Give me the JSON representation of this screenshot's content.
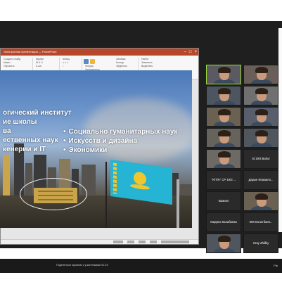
{
  "app": {
    "window_title": "Электронная презентация — PowerPoint",
    "window_buttons": [
      "–",
      "□",
      "×"
    ]
  },
  "ribbon": {
    "groups": [
      {
        "lines": [
          "Создать слайд",
          "Макет",
          "Сбросить"
        ]
      },
      {
        "lines": [
          "Шрифт",
          "Ж  К  Ч",
          "А  Аа"
        ]
      },
      {
        "lines": [
          "Абзац",
          "≡  ≡  ≡",
          "↕"
        ]
      },
      {
        "lines": [
          "Фигуры",
          "Упорядочить",
          "Экспресс"
        ]
      },
      {
        "lines": [
          "Заливка",
          "Контур",
          "Эффекты"
        ]
      },
      {
        "lines": [
          "Найти",
          "Заменить",
          "Выделить"
        ]
      }
    ],
    "accent": "#b7472a"
  },
  "slide": {
    "left_lines": [
      "огический институт",
      "ие школы",
      "ва",
      "ественных наук",
      "кенерии и IT"
    ],
    "right_bullets": [
      "Социально гуманитарных наук",
      "Искусств и дизайна",
      "Экономики"
    ]
  },
  "participants": [
    {
      "type": "video",
      "label": "",
      "active": true
    },
    {
      "type": "video",
      "label": "",
      "active": false
    },
    {
      "type": "video",
      "label": "",
      "active": false
    },
    {
      "type": "video",
      "label": "",
      "active": false
    },
    {
      "type": "video",
      "label": "",
      "active": false
    },
    {
      "type": "video",
      "label": "",
      "active": false
    },
    {
      "type": "video",
      "label": "",
      "active": false
    },
    {
      "type": "video",
      "label": "",
      "active": false
    },
    {
      "type": "video",
      "label": "",
      "active": false
    },
    {
      "type": "name",
      "label": "St 19/3 Bahur",
      "active": false
    },
    {
      "type": "name",
      "label": "\"КПТК\" СР 19/3 ...",
      "active": false
    },
    {
      "type": "name",
      "label": "Дарын Исмаило...",
      "active": false
    },
    {
      "type": "name",
      "label": "Камилл",
      "active": false
    },
    {
      "type": "video",
      "label": "",
      "active": false
    },
    {
      "type": "name",
      "label": "Мадина Калабаева",
      "active": false
    },
    {
      "type": "name",
      "label": "ККК Болатбаев...",
      "active": false
    },
    {
      "type": "video",
      "label": "",
      "active": false
    },
    {
      "type": "name",
      "label": "Gray Zhilbiy",
      "active": false
    }
  ],
  "bottom_bar": {
    "text": "Поделиться экраном с участниками 01:23",
    "icon_label": "Рф"
  },
  "colors": {
    "active_speaker": "#9bdc3a",
    "flag": "#26b4d4",
    "flag_symbol": "#f3c52c",
    "background": "#1f1f1f"
  }
}
